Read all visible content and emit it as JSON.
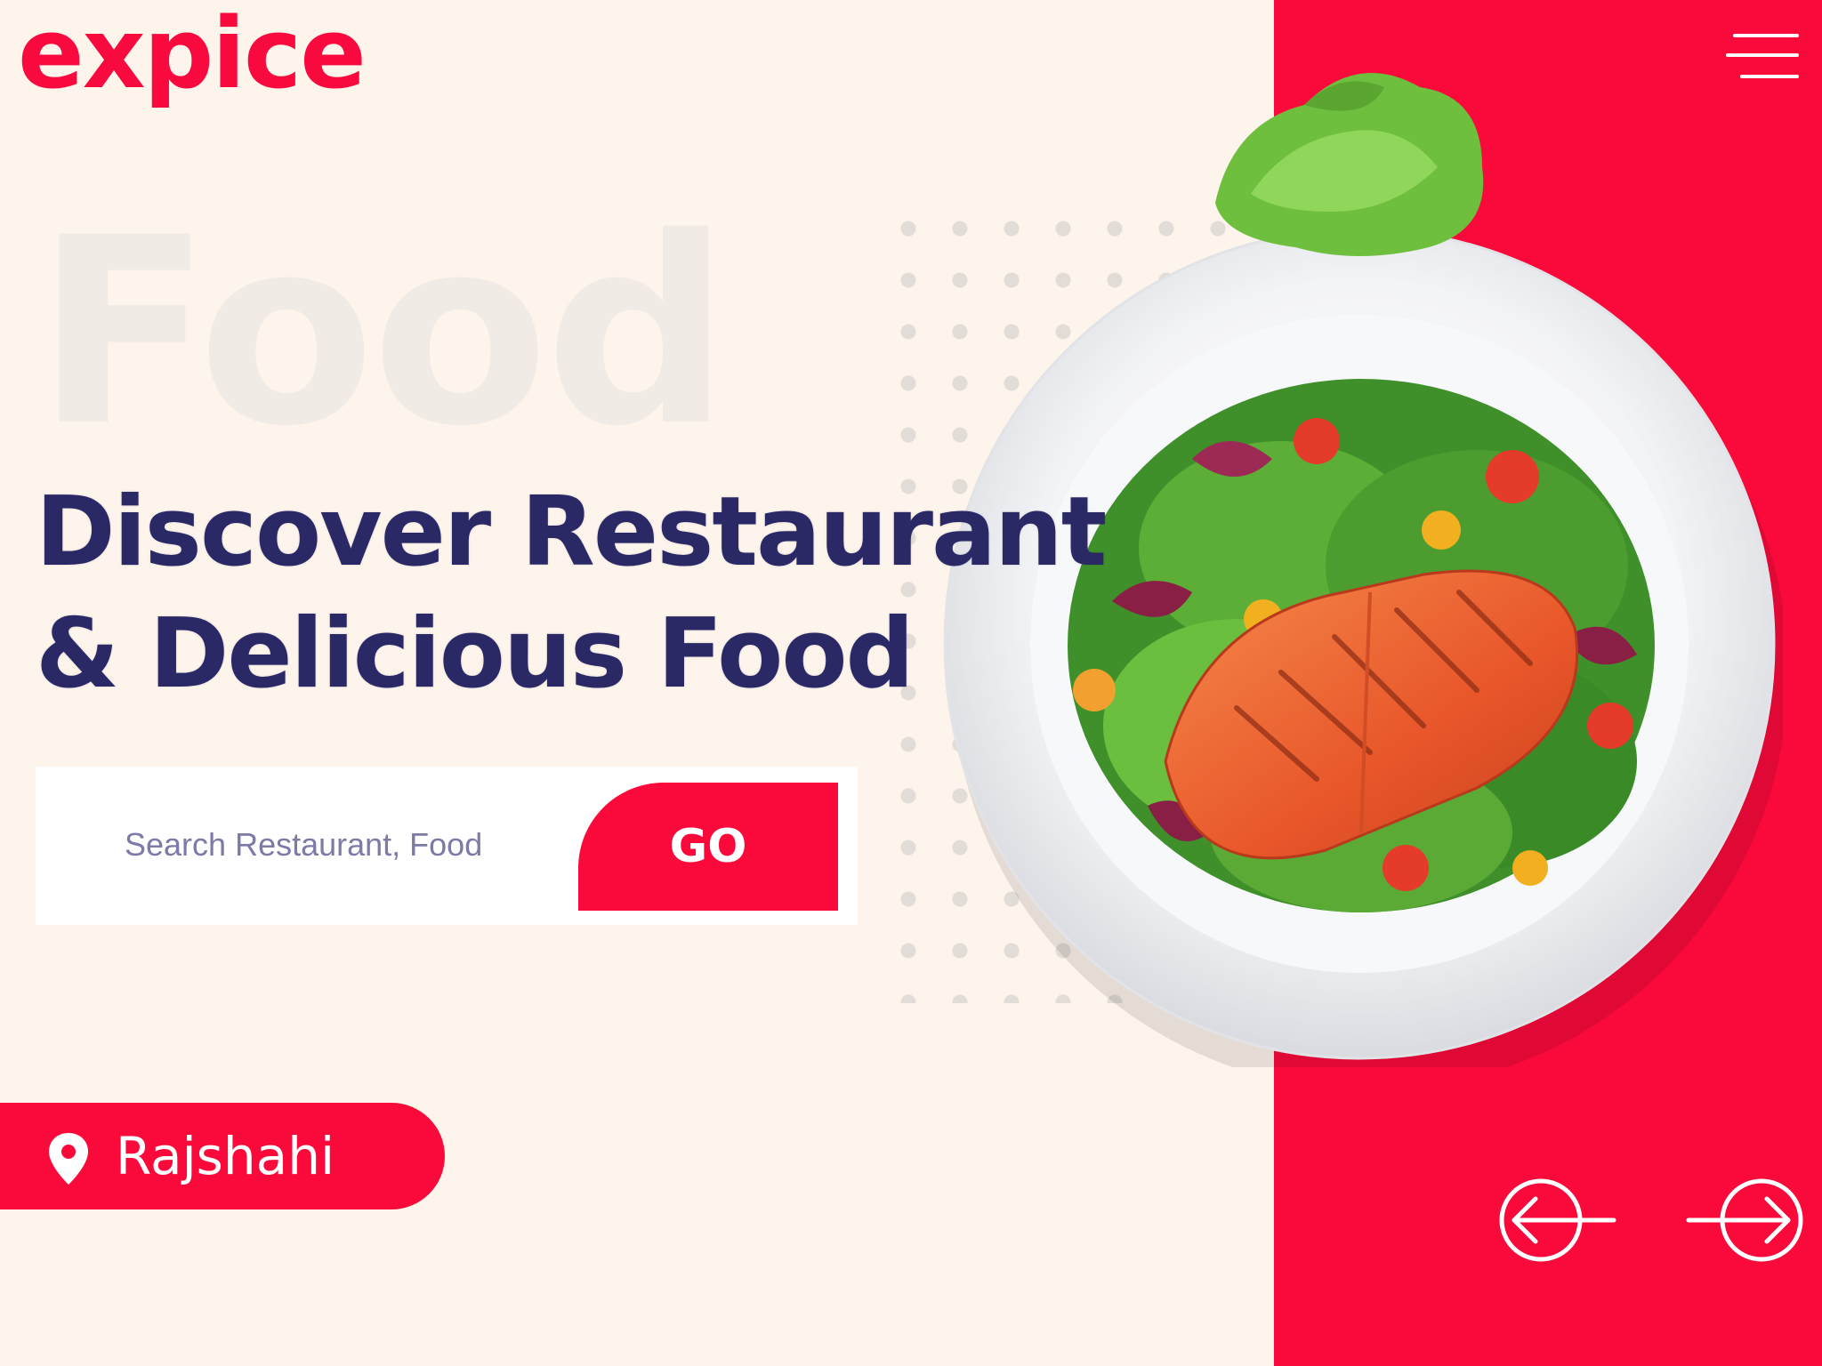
{
  "brand": {
    "logo_text": "expice"
  },
  "hero": {
    "background_word": "Food",
    "headline_line1": "Discover Restaurant",
    "headline_line2": "& Delicious Food"
  },
  "search": {
    "placeholder": "Search Restaurant, Food",
    "button_label": "GO"
  },
  "location": {
    "label": "Rajshahi",
    "icon": "map-pin-icon"
  },
  "navigation": {
    "menu_icon": "hamburger-menu-icon",
    "prev_icon": "arrow-left-icon",
    "next_icon": "arrow-right-icon"
  },
  "colors": {
    "accent": "#fa0a3b",
    "page_background": "#fdf4ec",
    "heading": "#2a2865",
    "search_button_text": "#ffffff"
  }
}
